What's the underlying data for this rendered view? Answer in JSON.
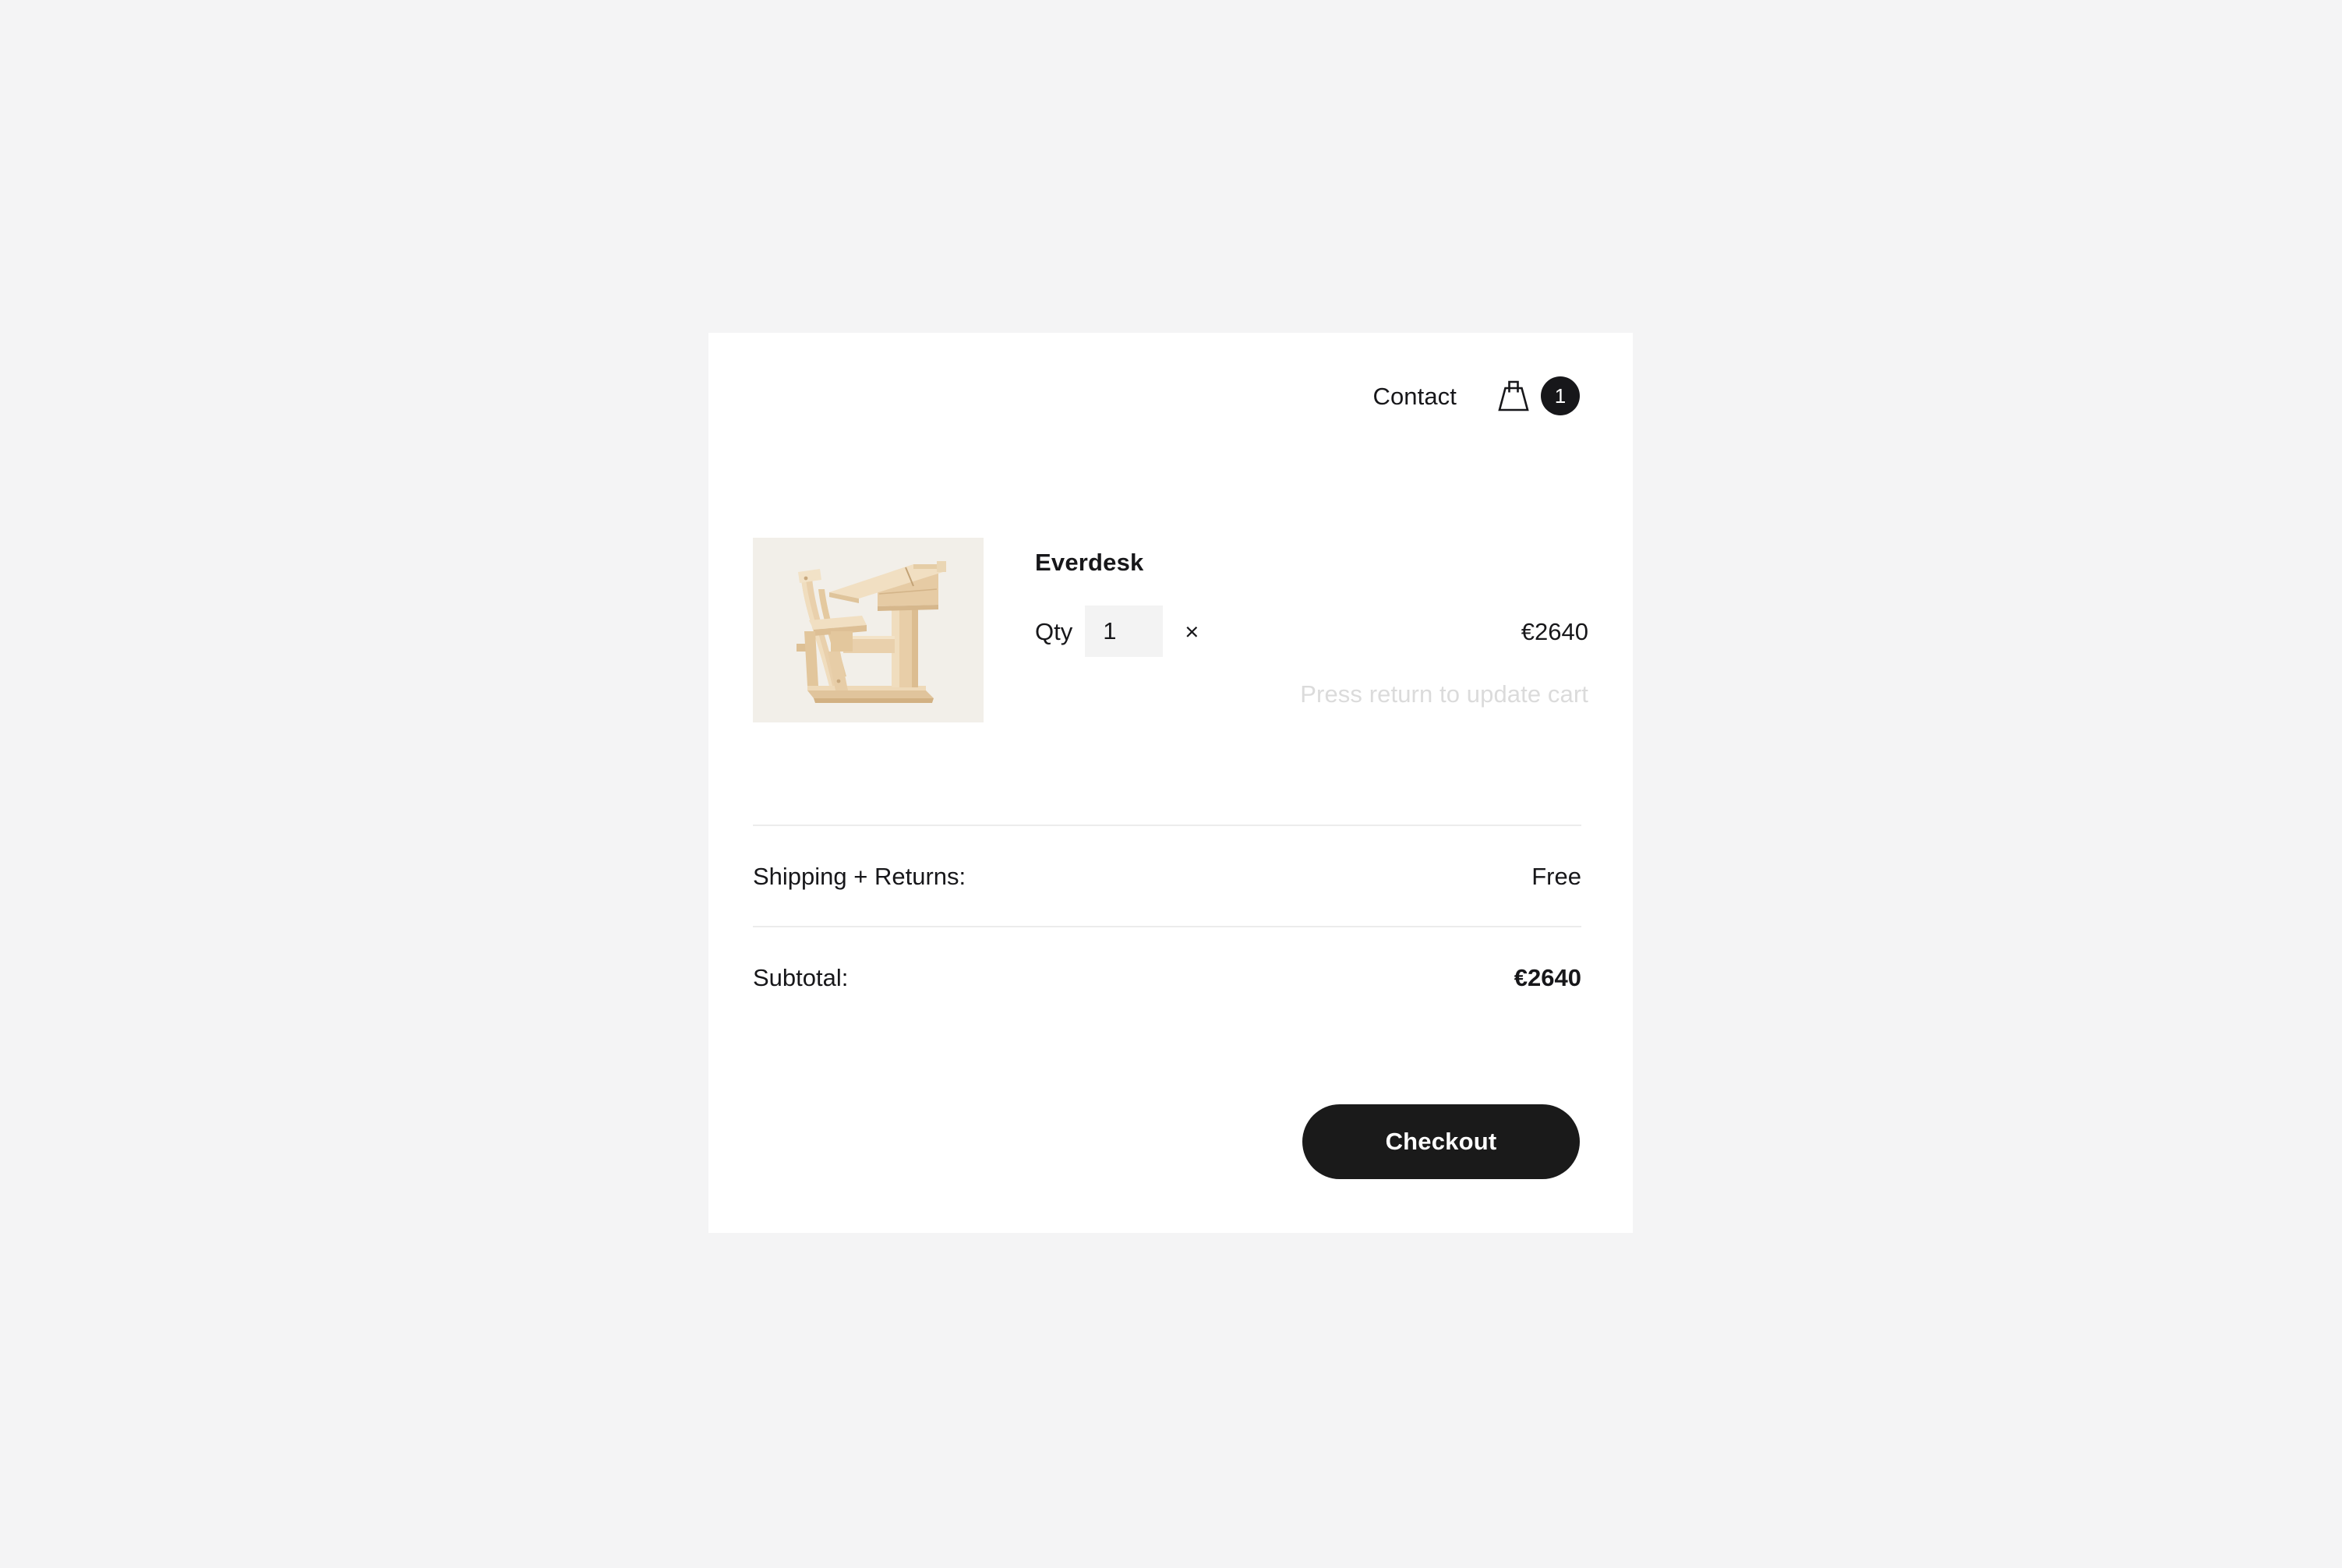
{
  "page": {
    "background_color": "#f4f4f5",
    "card_background": "#ffffff"
  },
  "header": {
    "contact_label": "Contact",
    "bag_icon": "shopping-bag-icon",
    "cart_count": "1",
    "badge_color": "#17171a"
  },
  "line_item": {
    "product_title": "Everdesk",
    "thumbnail_alt": "wooden-school-desk",
    "thumbnail_background": "#f2efe9",
    "qty_label": "Qty",
    "qty_value": "1",
    "qty_placeholder": "1",
    "multiply_symbol": "×",
    "price": "€2640",
    "update_hint": "Press return to update cart",
    "hint_color": "#dbdbdb"
  },
  "summary": {
    "rows": [
      {
        "label": "Shipping + Returns:",
        "value": "Free",
        "bold": false
      },
      {
        "label": "Subtotal:",
        "value": "€2640",
        "bold": true
      }
    ]
  },
  "actions": {
    "checkout_label": "Checkout",
    "checkout_color": "#1a1a1a"
  }
}
